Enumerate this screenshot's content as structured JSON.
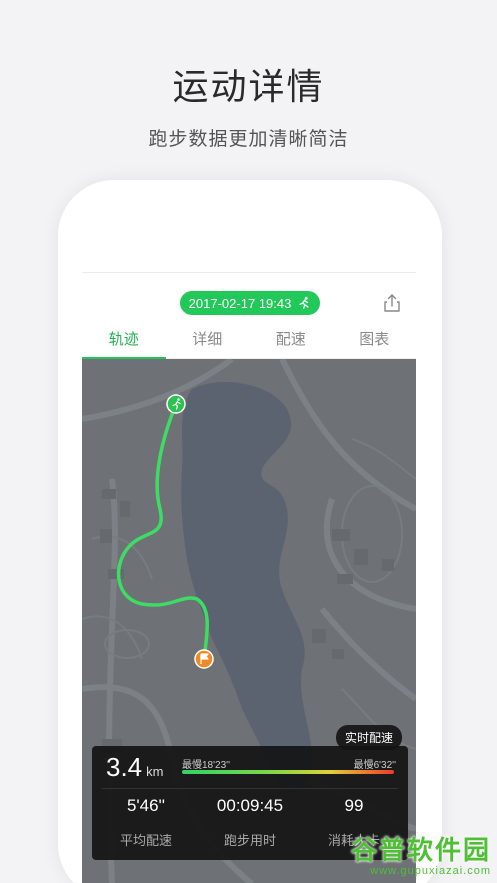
{
  "promo": {
    "title": "运动详情",
    "subtitle": "跑步数据更加清晰简洁"
  },
  "header": {
    "date": "2017-02-17 19:43",
    "run_icon": "runner-icon",
    "share_icon": "share-icon"
  },
  "tabs": [
    {
      "label": "轨迹",
      "active": true
    },
    {
      "label": "详细",
      "active": false
    },
    {
      "label": "配速",
      "active": false
    },
    {
      "label": "图表",
      "active": false
    }
  ],
  "map": {
    "realtime_pace_button": "实时配速",
    "start_icon": "runner-icon",
    "end_icon": "flag-icon",
    "route_color": "#3ddc63"
  },
  "stats": {
    "distance_value": "3.4",
    "distance_unit": "km",
    "fastest_label": "最慢18'23''",
    "slowest_label": "最慢6'32''",
    "avg_pace_value": "5'46''",
    "avg_pace_label": "平均配速",
    "duration_value": "00:09:45",
    "duration_label": "跑步用时",
    "calories_value": "99",
    "calories_label": "消耗大卡"
  },
  "watermark": {
    "name": "谷普软件园",
    "url": "www.gupuxiazai.com"
  },
  "colors": {
    "accent": "#23c85a",
    "map_bg": "#6e7277",
    "lake": "#5c6370"
  }
}
